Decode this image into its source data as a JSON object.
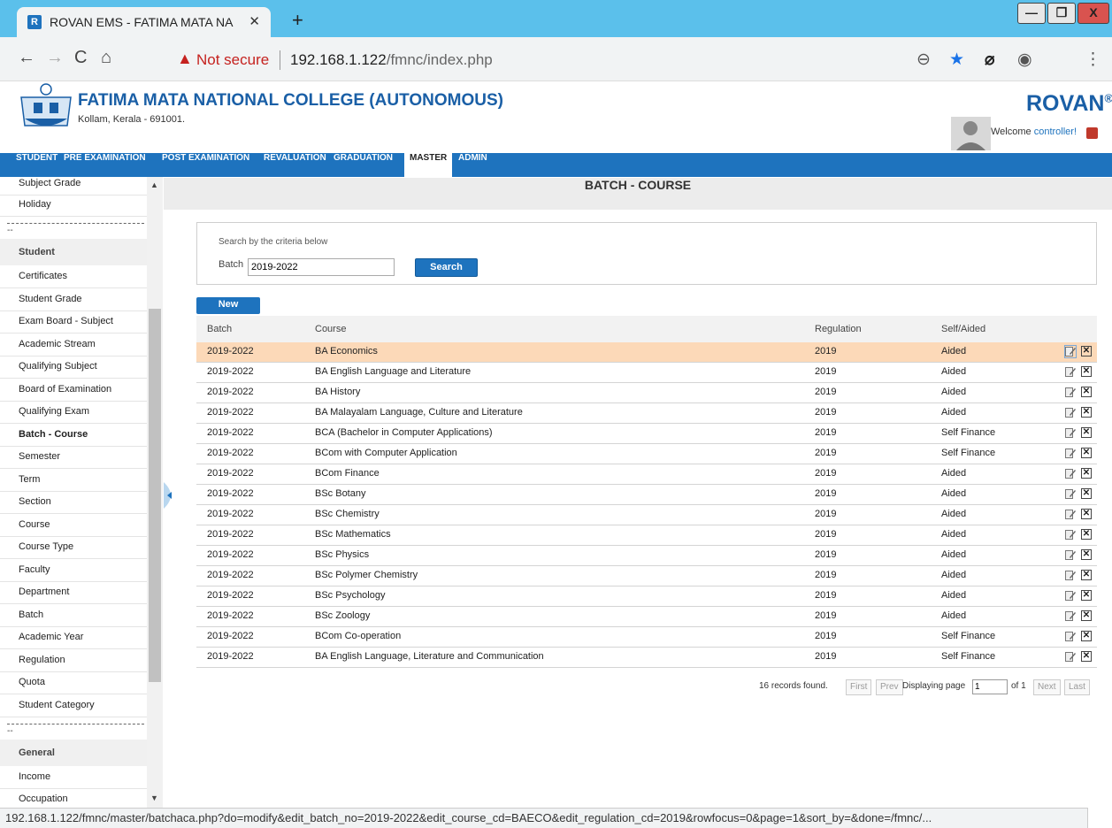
{
  "browser": {
    "tab_title": "ROVAN EMS - FATIMA MATA NA",
    "tab_favicon": "R",
    "not_secure": "Not secure",
    "url_host": "192.168.1.122",
    "url_path": "/fmnc/index.php",
    "status_url": "192.168.1.122/fmnc/master/batchaca.php?do=modify&edit_batch_no=2019-2022&edit_course_cd=BAECO&edit_regulation_cd=2019&rowfocus=0&page=1&sort_by=&done=/fmnc/..."
  },
  "header": {
    "college_name": "FATIMA MATA NATIONAL COLLEGE (AUTONOMOUS)",
    "college_address": "Kollam, Kerala - 691001.",
    "brand": "ROVAN",
    "brand_mark": "®",
    "welcome": "Welcome",
    "username": "controller!"
  },
  "nav": {
    "items": [
      "STUDENT",
      "PRE EXAMINATION",
      "POST EXAMINATION",
      "REVALUATION",
      "GRADUATION",
      "MASTER",
      "ADMIN"
    ],
    "active": "MASTER"
  },
  "sidebar": {
    "top_items": [
      "Subject Grade",
      "Holiday"
    ],
    "divider_dash": "--",
    "student_heading": "Student",
    "student_items": [
      "Certificates",
      "Student Grade",
      "Exam Board - Subject",
      "Academic Stream",
      "Qualifying Subject",
      "Board of Examination",
      "Qualifying Exam",
      "Batch - Course",
      "Semester",
      "Term",
      "Section",
      "Course",
      "Course Type",
      "Faculty",
      "Department",
      "Batch",
      "Academic Year",
      "Regulation",
      "Quota",
      "Student Category"
    ],
    "active_item": "Batch - Course",
    "general_heading": "General",
    "general_items": [
      "Income",
      "Occupation"
    ]
  },
  "page": {
    "title": "BATCH - COURSE",
    "search_caption": "Search by the criteria below",
    "batch_label": "Batch",
    "batch_value": "2019-2022",
    "search_button": "Search",
    "new_button": "New"
  },
  "table": {
    "headers": [
      "Batch",
      "Course",
      "Regulation",
      "Self/Aided"
    ],
    "rows": [
      [
        "2019-2022",
        "BA Economics",
        "2019",
        "Aided"
      ],
      [
        "2019-2022",
        "BA English Language and Literature",
        "2019",
        "Aided"
      ],
      [
        "2019-2022",
        "BA History",
        "2019",
        "Aided"
      ],
      [
        "2019-2022",
        "BA Malayalam Language, Culture and Literature",
        "2019",
        "Aided"
      ],
      [
        "2019-2022",
        "BCA (Bachelor in Computer Applications)",
        "2019",
        "Self Finance"
      ],
      [
        "2019-2022",
        "BCom with Computer Application",
        "2019",
        "Self Finance"
      ],
      [
        "2019-2022",
        "BCom Finance",
        "2019",
        "Aided"
      ],
      [
        "2019-2022",
        "BSc Botany",
        "2019",
        "Aided"
      ],
      [
        "2019-2022",
        "BSc Chemistry",
        "2019",
        "Aided"
      ],
      [
        "2019-2022",
        "BSc Mathematics",
        "2019",
        "Aided"
      ],
      [
        "2019-2022",
        "BSc Physics",
        "2019",
        "Aided"
      ],
      [
        "2019-2022",
        "BSc Polymer Chemistry",
        "2019",
        "Aided"
      ],
      [
        "2019-2022",
        "BSc Psychology",
        "2019",
        "Aided"
      ],
      [
        "2019-2022",
        "BSc Zoology",
        "2019",
        "Aided"
      ],
      [
        "2019-2022",
        "BCom Co-operation",
        "2019",
        "Self Finance"
      ],
      [
        "2019-2022",
        "BA English Language, Literature and Communication",
        "2019",
        "Self Finance"
      ]
    ],
    "selected_row": 0
  },
  "pager": {
    "records": "16 records found.",
    "first": "First",
    "prev": "Prev",
    "displaying": "Displaying page",
    "page": "1",
    "of": "of 1",
    "next": "Next",
    "last": "Last"
  },
  "colors": {
    "nav_blue": "#1e73be",
    "selected_row": "#fcd9b8",
    "titlebar": "#5bc0eb"
  }
}
